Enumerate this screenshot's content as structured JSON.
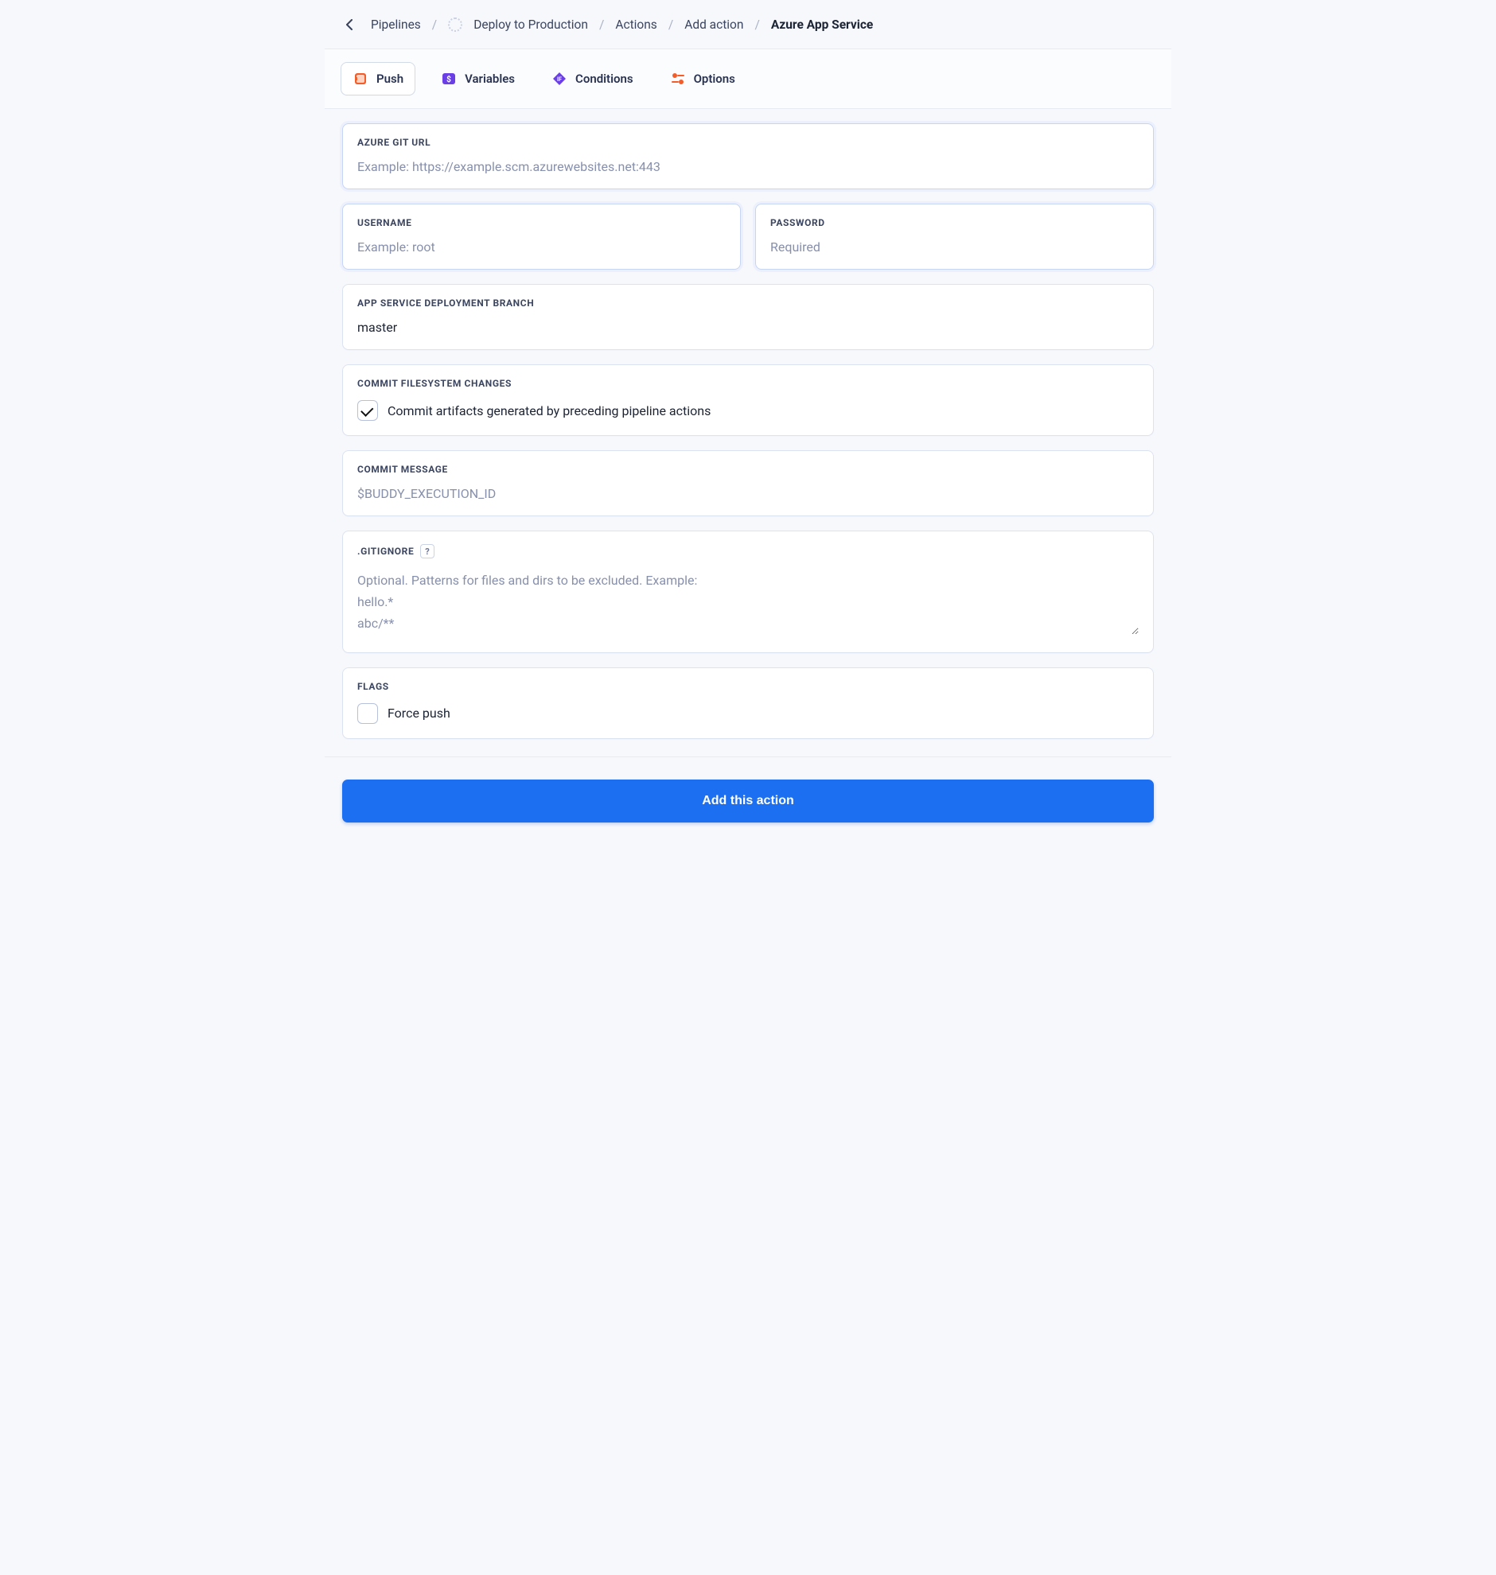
{
  "breadcrumb": {
    "items": [
      {
        "label": "Pipelines"
      },
      {
        "label": "Deploy to Production",
        "spinner": true
      },
      {
        "label": "Actions"
      },
      {
        "label": "Add action"
      },
      {
        "label": "Azure App Service",
        "current": true
      }
    ]
  },
  "tabs": [
    {
      "id": "push",
      "label": "Push",
      "active": true,
      "iconColor": "#f25d2a"
    },
    {
      "id": "variables",
      "label": "Variables",
      "active": false,
      "iconColor": "#6a3fe6"
    },
    {
      "id": "conditions",
      "label": "Conditions",
      "active": false,
      "iconColor": "#6a3fe6"
    },
    {
      "id": "options",
      "label": "Options",
      "active": false,
      "iconColor": "#f25d2a"
    }
  ],
  "fields": {
    "azure_git_url": {
      "label": "AZURE GIT URL",
      "placeholder": "Example: https://example.scm.azurewebsites.net:443",
      "value": ""
    },
    "username": {
      "label": "USERNAME",
      "placeholder": "Example: root",
      "value": ""
    },
    "password": {
      "label": "PASSWORD",
      "placeholder": "Required",
      "value": ""
    },
    "deployment_branch": {
      "label": "APP SERVICE DEPLOYMENT BRANCH",
      "value": "master"
    },
    "commit_fs_changes": {
      "label": "COMMIT FILESYSTEM CHANGES",
      "checkbox_label": "Commit artifacts generated by preceding pipeline actions",
      "checked": true
    },
    "commit_message": {
      "label": "COMMIT MESSAGE",
      "placeholder": "$BUDDY_EXECUTION_ID",
      "value": ""
    },
    "gitignore": {
      "label": ".GITIGNORE",
      "help": "?",
      "placeholder": "Optional. Patterns for files and dirs to be excluded. Example:\nhello.*\nabc/**",
      "value": ""
    },
    "flags": {
      "label": "FLAGS",
      "force_push_label": "Force push",
      "force_push_checked": false
    }
  },
  "footer": {
    "submit_label": "Add this action"
  }
}
